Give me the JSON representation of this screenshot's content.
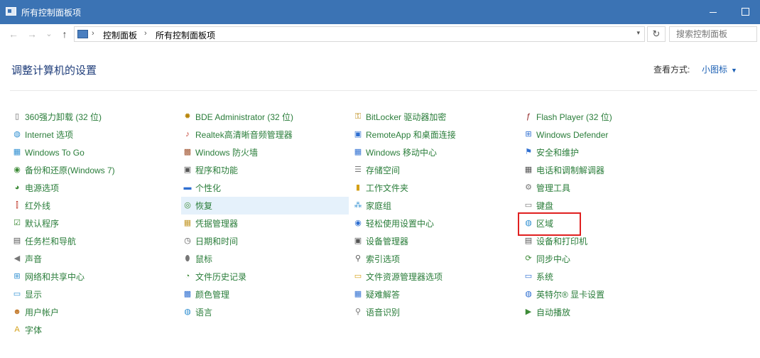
{
  "window": {
    "title": "所有控制面板项"
  },
  "nav": {
    "back": "←",
    "forward": "→",
    "recent": "⌄",
    "up": "↑",
    "breadcrumb": [
      "控制面板",
      "所有控制面板项"
    ],
    "separator": "›",
    "refresh": "↻",
    "search_placeholder": "搜索控制面板"
  },
  "header": {
    "title": "调整计算机的设置",
    "view_by_label": "查看方式:",
    "view_by_value": "小图标"
  },
  "colors": {
    "link": "#2a7d3a",
    "accent": "#3b73b4",
    "hover": "#e5f1fb",
    "highlight": "#e02020"
  },
  "columns": [
    [
      {
        "label": "360强力卸载 (32 位)",
        "icon": "uninstall-icon",
        "glyph": "▯",
        "color": "#666666"
      },
      {
        "label": "Internet 选项",
        "icon": "globe-icon",
        "glyph": "◍",
        "color": "#2f8fd1"
      },
      {
        "label": "Windows To Go",
        "icon": "windows-to-go-icon",
        "glyph": "▦",
        "color": "#2f8fd1"
      },
      {
        "label": "备份和还原(Windows 7)",
        "icon": "backup-icon",
        "glyph": "◉",
        "color": "#3d8b37"
      },
      {
        "label": "电源选项",
        "icon": "power-icon",
        "glyph": "◕",
        "color": "#3d8b37"
      },
      {
        "label": "红外线",
        "icon": "infrared-icon",
        "glyph": "⫿",
        "color": "#c0392b"
      },
      {
        "label": "默认程序",
        "icon": "default-programs-icon",
        "glyph": "☑",
        "color": "#3d8b37"
      },
      {
        "label": "任务栏和导航",
        "icon": "taskbar-icon",
        "glyph": "▤",
        "color": "#555555"
      },
      {
        "label": "声音",
        "icon": "speaker-icon",
        "glyph": "◀",
        "color": "#777777"
      },
      {
        "label": "网络和共享中心",
        "icon": "network-icon",
        "glyph": "⊞",
        "color": "#2f8fd1"
      },
      {
        "label": "显示",
        "icon": "display-icon",
        "glyph": "▭",
        "color": "#2f8fd1"
      },
      {
        "label": "用户帐户",
        "icon": "users-icon",
        "glyph": "☻",
        "color": "#c47a2c"
      },
      {
        "label": "字体",
        "icon": "fonts-icon",
        "glyph": "A",
        "color": "#d4a017"
      }
    ],
    [
      {
        "label": "BDE Administrator (32 位)",
        "icon": "bde-admin-icon",
        "glyph": "✹",
        "color": "#b8860b"
      },
      {
        "label": "Realtek高清晰音频管理器",
        "icon": "realtek-audio-icon",
        "glyph": "♪",
        "color": "#c0392b"
      },
      {
        "label": "Windows 防火墙",
        "icon": "firewall-icon",
        "glyph": "▩",
        "color": "#a0522d"
      },
      {
        "label": "程序和功能",
        "icon": "programs-icon",
        "glyph": "▣",
        "color": "#555555"
      },
      {
        "label": "个性化",
        "icon": "personalize-icon",
        "glyph": "▬",
        "color": "#2f6fd1"
      },
      {
        "label": "恢复",
        "icon": "recovery-icon",
        "glyph": "◎",
        "color": "#3d8b37",
        "hover": true
      },
      {
        "label": "凭据管理器",
        "icon": "credential-icon",
        "glyph": "▦",
        "color": "#c49a2c"
      },
      {
        "label": "日期和时间",
        "icon": "clock-icon",
        "glyph": "◷",
        "color": "#555555"
      },
      {
        "label": "鼠标",
        "icon": "mouse-icon",
        "glyph": "⬮",
        "color": "#777777"
      },
      {
        "label": "文件历史记录",
        "icon": "file-history-icon",
        "glyph": "◔",
        "color": "#3d8b37"
      },
      {
        "label": "颜色管理",
        "icon": "color-management-icon",
        "glyph": "▩",
        "color": "#2f6fd1"
      },
      {
        "label": "语言",
        "icon": "language-icon",
        "glyph": "◍",
        "color": "#2f8fd1"
      }
    ],
    [
      {
        "label": "BitLocker 驱动器加密",
        "icon": "bitlocker-icon",
        "glyph": "⚿",
        "color": "#b8860b"
      },
      {
        "label": "RemoteApp 和桌面连接",
        "icon": "remoteapp-icon",
        "glyph": "▣",
        "color": "#2f6fd1"
      },
      {
        "label": "Windows 移动中心",
        "icon": "mobility-center-icon",
        "glyph": "▦",
        "color": "#2f6fd1"
      },
      {
        "label": "存储空间",
        "icon": "storage-icon",
        "glyph": "☰",
        "color": "#777777"
      },
      {
        "label": "工作文件夹",
        "icon": "work-folders-icon",
        "glyph": "▮",
        "color": "#d4a017"
      },
      {
        "label": "家庭组",
        "icon": "homegroup-icon",
        "glyph": "⁂",
        "color": "#2f8fd1"
      },
      {
        "label": "轻松使用设置中心",
        "icon": "ease-of-access-icon",
        "glyph": "◉",
        "color": "#2f6fd1"
      },
      {
        "label": "设备管理器",
        "icon": "device-manager-icon",
        "glyph": "▣",
        "color": "#555555"
      },
      {
        "label": "索引选项",
        "icon": "indexing-icon",
        "glyph": "⚲",
        "color": "#555555"
      },
      {
        "label": "文件资源管理器选项",
        "icon": "explorer-options-icon",
        "glyph": "▭",
        "color": "#d4a017"
      },
      {
        "label": "疑难解答",
        "icon": "troubleshoot-icon",
        "glyph": "▦",
        "color": "#2f6fd1"
      },
      {
        "label": "语音识别",
        "icon": "microphone-icon",
        "glyph": "⚲",
        "color": "#777777"
      }
    ],
    [
      {
        "label": "Flash Player (32 位)",
        "icon": "flash-icon",
        "glyph": "ƒ",
        "color": "#8b1a1a"
      },
      {
        "label": "Windows Defender",
        "icon": "defender-icon",
        "glyph": "⊞",
        "color": "#2f6fd1"
      },
      {
        "label": "安全和维护",
        "icon": "flag-icon",
        "glyph": "⚑",
        "color": "#2f6fd1"
      },
      {
        "label": "电话和调制解调器",
        "icon": "phone-modem-icon",
        "glyph": "▦",
        "color": "#555555"
      },
      {
        "label": "管理工具",
        "icon": "admin-tools-icon",
        "glyph": "⚙",
        "color": "#777777"
      },
      {
        "label": "键盘",
        "icon": "keyboard-icon",
        "glyph": "▭",
        "color": "#777777"
      },
      {
        "label": "区域",
        "icon": "region-icon",
        "glyph": "◍",
        "color": "#2f8fd1",
        "highlight": true
      },
      {
        "label": "设备和打印机",
        "icon": "printer-icon",
        "glyph": "▤",
        "color": "#555555"
      },
      {
        "label": "同步中心",
        "icon": "sync-icon",
        "glyph": "⟳",
        "color": "#3d8b37"
      },
      {
        "label": "系统",
        "icon": "system-icon",
        "glyph": "▭",
        "color": "#2f6fd1"
      },
      {
        "label": "英特尔® 显卡设置",
        "icon": "intel-graphics-icon",
        "glyph": "◍",
        "color": "#2f6fd1"
      },
      {
        "label": "自动播放",
        "icon": "autoplay-icon",
        "glyph": "▶",
        "color": "#3d8b37"
      }
    ]
  ]
}
